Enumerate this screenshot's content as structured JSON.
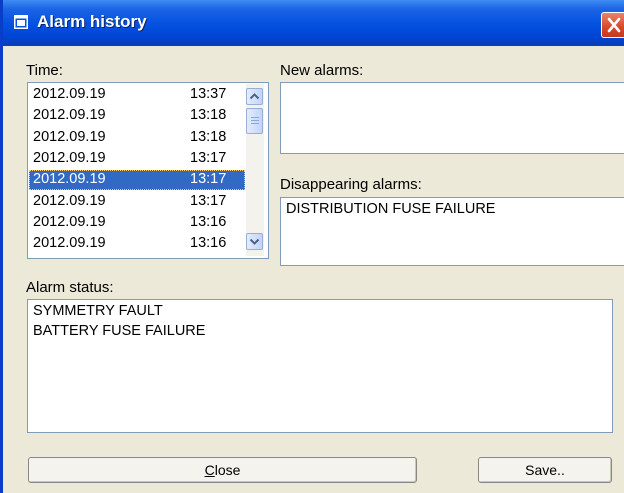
{
  "window": {
    "title": "Alarm history"
  },
  "time_list": {
    "label": "Time:",
    "rows": [
      {
        "date": "2012.09.19",
        "time": "13:37"
      },
      {
        "date": "2012.09.19",
        "time": "13:18"
      },
      {
        "date": "2012.09.19",
        "time": "13:18"
      },
      {
        "date": "2012.09.19",
        "time": "13:17"
      },
      {
        "date": "2012.09.19",
        "time": "13:17",
        "selected": true
      },
      {
        "date": "2012.09.19",
        "time": "13:17"
      },
      {
        "date": "2012.09.19",
        "time": "13:16"
      },
      {
        "date": "2012.09.19",
        "time": "13:16"
      }
    ]
  },
  "new_alarms": {
    "label": "New alarms:",
    "items": []
  },
  "disappearing_alarms": {
    "label": "Disappearing alarms:",
    "items": [
      "DISTRIBUTION FUSE FAILURE"
    ]
  },
  "alarm_status": {
    "label": "Alarm status:",
    "items": [
      "SYMMETRY FAULT",
      "BATTERY FUSE FAILURE"
    ]
  },
  "buttons": {
    "close_first": "C",
    "close_rest": "lose",
    "save": "Save.."
  },
  "colors": {
    "title_bar": "#0553e2",
    "selection": "#316ac5",
    "window_bg": "#ece9d8"
  },
  "icons": {
    "title": "window-icon",
    "close": "close-x-icon",
    "scroll_up": "scroll-up-arrow-icon",
    "scroll_down": "scroll-down-arrow-icon"
  }
}
